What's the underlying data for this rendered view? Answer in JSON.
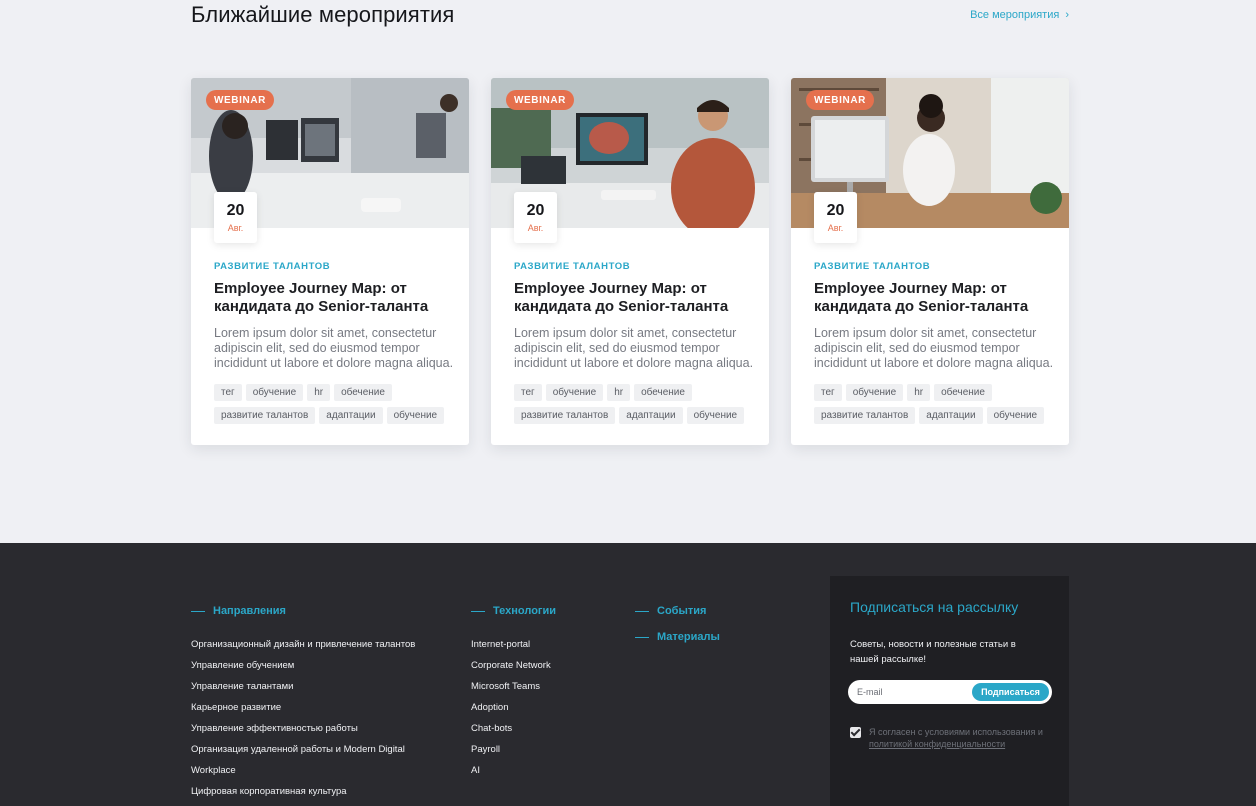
{
  "events": {
    "title": "Ближайшие мероприятия",
    "all_link": "Все мероприятия",
    "cards": [
      {
        "badge": "WEBINAR",
        "day": "20",
        "month": "Авг.",
        "category": "РАЗВИТИЕ ТАЛАНТОВ",
        "title": "Employee Journey Map: от кандидата до Senior-таланта",
        "description": "Lorem ipsum dolor sit amet, consectetur adipiscin elit, sed do eiusmod tempor incididunt ut labore et dolore magna aliqua.",
        "tags": [
          "тег",
          "обучение",
          "hr",
          "обечение",
          "развитие талантов",
          "адаптации",
          "обучение"
        ]
      },
      {
        "badge": "WEBINAR",
        "day": "20",
        "month": "Авг.",
        "category": "РАЗВИТИЕ ТАЛАНТОВ",
        "title": "Employee Journey Map: от кандидата до Senior-таланта",
        "description": "Lorem ipsum dolor sit amet, consectetur adipiscin elit, sed do eiusmod tempor incididunt ut labore et dolore magna aliqua.",
        "tags": [
          "тег",
          "обучение",
          "hr",
          "обечение",
          "развитие талантов",
          "адаптации",
          "обучение"
        ]
      },
      {
        "badge": "WEBINAR",
        "day": "20",
        "month": "Авг.",
        "category": "РАЗВИТИЕ ТАЛАНТОВ",
        "title": "Employee Journey Map: от кандидата до Senior-таланта",
        "description": "Lorem ipsum dolor sit amet, consectetur adipiscin elit, sed do eiusmod tempor incididunt ut labore et dolore magna aliqua.",
        "tags": [
          "тег",
          "обучение",
          "hr",
          "обечение",
          "развитие талантов",
          "адаптации",
          "обучение"
        ]
      }
    ]
  },
  "footer": {
    "directions": {
      "heading": "Направления",
      "links": [
        "Организационный дизайн и привлечение талантов",
        "Управление обучением",
        "Управление талантами",
        "Карьерное развитие",
        "Управление эффективностью работы",
        "Организация удаленной работы и Modern Digital",
        "Workplace",
        "Цифровая корпоративная культура"
      ]
    },
    "technologies": {
      "heading": "Технологии",
      "links": [
        "Internet-portal",
        "Corporate Network",
        "Microsoft Teams",
        "Adoption",
        "Chat-bots",
        "Payroll",
        "AI"
      ]
    },
    "events_heading": "События",
    "materials_heading": "Материалы",
    "subscribe": {
      "title": "Подписаться на рассылку",
      "text": "Советы, новости и полезные статьи в нашей рассылке!",
      "placeholder": "E-mail",
      "button": "Подписаться",
      "consent_text": "Я согласен с условиями использования и",
      "consent_link": "политикой конфиденциальности",
      "consent_checked": true
    }
  },
  "colors": {
    "accent": "#2ba7c8",
    "badge": "#e5704d",
    "footer_bg": "#2a2a2f",
    "page_bg": "#eff0f4"
  }
}
